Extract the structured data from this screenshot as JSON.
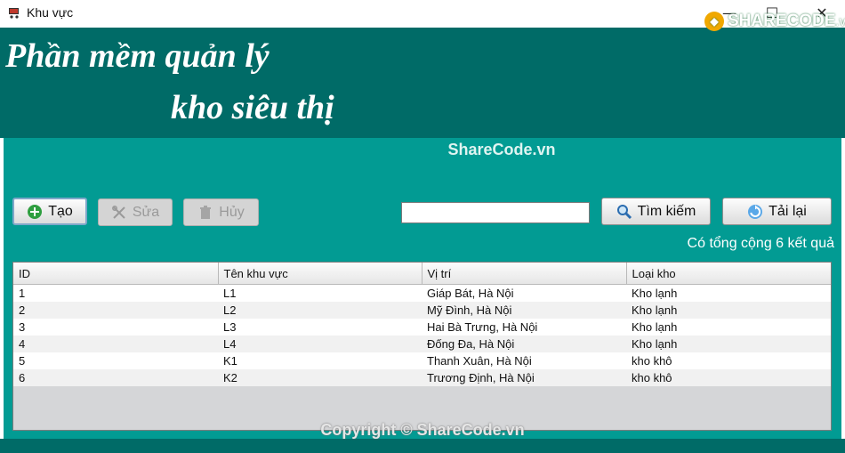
{
  "window": {
    "title": "Khu vực",
    "minimize": "—",
    "maximize": "☐",
    "close": "✕"
  },
  "logo": {
    "main": "SHARECODE",
    "suffix": ".vn"
  },
  "header": {
    "line1": "Phần mềm quản lý",
    "line2": "kho siêu thị"
  },
  "watermark_top": "ShareCode.vn",
  "toolbar": {
    "create": "Tạo",
    "edit": "Sửa",
    "delete": "Hủy",
    "search": "Tìm kiếm",
    "reload": "Tải lại"
  },
  "search": {
    "value": "",
    "placeholder": ""
  },
  "result_count": "Có tổng cộng 6 kết quả",
  "table": {
    "columns": [
      "ID",
      "Tên khu vực",
      "Vị trí",
      "Loại kho"
    ],
    "rows": [
      [
        "1",
        "L1",
        "Giáp Bát, Hà Nội",
        "Kho lạnh"
      ],
      [
        "2",
        "L2",
        "Mỹ Đình, Hà Nội",
        "Kho lạnh"
      ],
      [
        "3",
        "L3",
        "Hai Bà Trưng, Hà Nội",
        "Kho lạnh"
      ],
      [
        "4",
        "L4",
        "Đống Đa, Hà Nội",
        "Kho lạnh"
      ],
      [
        "5",
        "K1",
        "Thanh Xuân, Hà Nội",
        "kho khô"
      ],
      [
        "6",
        "K2",
        "Trương Định, Hà Nội",
        "kho khô"
      ]
    ]
  },
  "watermark_bottom": "Copyright © ShareCode.vn",
  "colors": {
    "header_bg": "#006b67",
    "content_bg": "#029b93"
  }
}
